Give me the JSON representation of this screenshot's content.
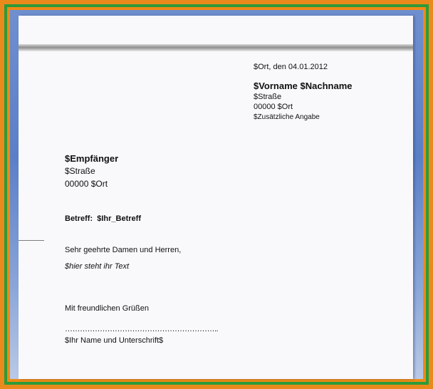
{
  "letter": {
    "place_date": "$Ort, den 04.01.2012",
    "sender": {
      "name": "$Vorname $Nachname",
      "street": "$Straße",
      "city": "00000 $Ort",
      "extra": "$Zusätzliche Angabe"
    },
    "recipient": {
      "name": "$Empfänger",
      "street": "$Straße",
      "city": "00000 $Ort"
    },
    "subject_label": "Betreff:",
    "subject_value": "$Ihr_Betreff",
    "salutation": "Sehr geehrte Damen und Herren,",
    "body_text": "$hier steht ihr Text",
    "closing": "Mit freundlichen Grüßen",
    "signature_line": "……………………………………………………..",
    "signature_caption": "$Ihr Name und Unterschrift$"
  }
}
